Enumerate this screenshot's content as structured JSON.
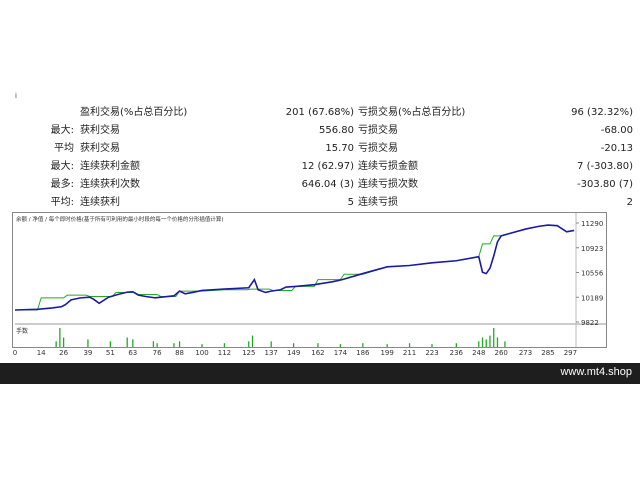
{
  "corner_mark": "i",
  "stats": [
    {
      "label1": "",
      "label2": "盈利交易(%占总百分比)",
      "value1": "201 (67.68%)",
      "label3": "亏损交易(%占总百分比)",
      "value2": "96 (32.32%)"
    },
    {
      "label1": "最大:",
      "label2": "获利交易",
      "value1": "556.80",
      "label3": "亏损交易",
      "value2": "-68.00"
    },
    {
      "label1": "平均",
      "label2": "获利交易",
      "value1": "15.70",
      "label3": "亏损交易",
      "value2": "-20.13"
    },
    {
      "label1": "最大:",
      "label2": "连续获利金额",
      "value1": "12 (62.97)",
      "label3": "连续亏损金额",
      "value2": "7 (-303.80)"
    },
    {
      "label1": "最多:",
      "label2": "连续获利次数",
      "value1": "646.04 (3)",
      "label3": "连续亏损次数",
      "value2": "-303.80 (7)"
    },
    {
      "label1": "平均:",
      "label2": "连续获利",
      "value1": "5",
      "label3": "连续亏损",
      "value2": "2"
    }
  ],
  "chart_data": {
    "type": "line",
    "legend_text": "余额 / 净值 / 每个即时价格(基于所有可利用的最小时段的每一个价格的分形插值计算)",
    "colors": {
      "balance": "#1a1aa6",
      "equity": "#22aa22",
      "volume": "#22aa22"
    },
    "y_ticks": [
      11290,
      10923,
      10556,
      10189,
      9822
    ],
    "ylim": [
      9822,
      11290
    ],
    "x_ticks": [
      0,
      14,
      26,
      39,
      51,
      63,
      76,
      88,
      100,
      112,
      125,
      137,
      149,
      162,
      174,
      186,
      199,
      211,
      223,
      236,
      248,
      260,
      273,
      285,
      297
    ],
    "xlim": [
      0,
      300
    ],
    "series": [
      {
        "name": "余额",
        "x": [
          0,
          12,
          20,
          25,
          27,
          30,
          35,
          40,
          42,
          45,
          50,
          55,
          60,
          63,
          66,
          70,
          75,
          80,
          85,
          88,
          91,
          95,
          100,
          112,
          125,
          128,
          130,
          134,
          137,
          142,
          145,
          150,
          160,
          170,
          175,
          186,
          199,
          211,
          223,
          236,
          248,
          250,
          252,
          254,
          256,
          258,
          260,
          273,
          280,
          285,
          290,
          295,
          299
        ],
        "y": [
          10000,
          10010,
          10030,
          10050,
          10080,
          10150,
          10180,
          10190,
          10160,
          10100,
          10190,
          10230,
          10265,
          10270,
          10220,
          10200,
          10180,
          10195,
          10210,
          10280,
          10240,
          10260,
          10290,
          10310,
          10330,
          10450,
          10300,
          10260,
          10280,
          10300,
          10340,
          10350,
          10375,
          10420,
          10450,
          10540,
          10640,
          10660,
          10700,
          10730,
          10790,
          10560,
          10540,
          10620,
          10800,
          11010,
          11100,
          11200,
          11240,
          11260,
          11250,
          11160,
          11180
        ]
      },
      {
        "name": "净值",
        "x": [
          0,
          12,
          14,
          26,
          28,
          38,
          40,
          52,
          54,
          64,
          66,
          76,
          78,
          86,
          88,
          100,
          112,
          124,
          126,
          136,
          138,
          148,
          150,
          160,
          162,
          174,
          176,
          186,
          199,
          211,
          223,
          236,
          248,
          250,
          254,
          256,
          260,
          273,
          280,
          285,
          290,
          295,
          299
        ],
        "y": [
          10000,
          10000,
          10180,
          10180,
          10220,
          10220,
          10200,
          10200,
          10260,
          10260,
          10230,
          10230,
          10200,
          10200,
          10280,
          10280,
          10300,
          10300,
          10310,
          10310,
          10290,
          10290,
          10350,
          10350,
          10450,
          10450,
          10530,
          10530,
          10640,
          10660,
          10700,
          10730,
          10790,
          10980,
          10980,
          11100,
          11100,
          11200,
          11240,
          11260,
          11250,
          11160,
          11180
        ]
      }
    ],
    "volume_label": "手数",
    "volume": [
      {
        "x": 22,
        "v": 0.3
      },
      {
        "x": 24,
        "v": 1.0
      },
      {
        "x": 26,
        "v": 0.5
      },
      {
        "x": 39,
        "v": 0.4
      },
      {
        "x": 51,
        "v": 0.3
      },
      {
        "x": 60,
        "v": 0.5
      },
      {
        "x": 63,
        "v": 0.4
      },
      {
        "x": 74,
        "v": 0.3
      },
      {
        "x": 76,
        "v": 0.2
      },
      {
        "x": 85,
        "v": 0.2
      },
      {
        "x": 88,
        "v": 0.3
      },
      {
        "x": 100,
        "v": 0.15
      },
      {
        "x": 112,
        "v": 0.2
      },
      {
        "x": 125,
        "v": 0.3
      },
      {
        "x": 127,
        "v": 0.6
      },
      {
        "x": 137,
        "v": 0.3
      },
      {
        "x": 149,
        "v": 0.2
      },
      {
        "x": 162,
        "v": 0.2
      },
      {
        "x": 174,
        "v": 0.15
      },
      {
        "x": 186,
        "v": 0.2
      },
      {
        "x": 199,
        "v": 0.15
      },
      {
        "x": 211,
        "v": 0.2
      },
      {
        "x": 223,
        "v": 0.15
      },
      {
        "x": 236,
        "v": 0.2
      },
      {
        "x": 248,
        "v": 0.3
      },
      {
        "x": 250,
        "v": 0.5
      },
      {
        "x": 252,
        "v": 0.4
      },
      {
        "x": 254,
        "v": 0.6
      },
      {
        "x": 256,
        "v": 1.0
      },
      {
        "x": 258,
        "v": 0.5
      },
      {
        "x": 262,
        "v": 0.3
      }
    ]
  },
  "footer": {
    "text": "www.mt4.shop"
  }
}
